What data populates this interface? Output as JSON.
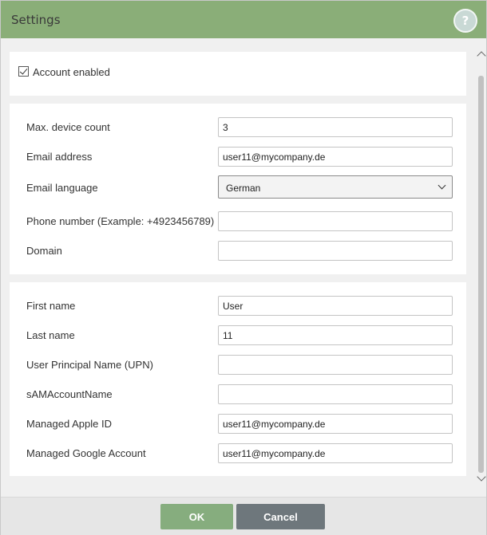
{
  "dialog": {
    "title": "Settings",
    "help_label": "?"
  },
  "account": {
    "enabled_label": "Account enabled",
    "enabled": true
  },
  "device_section": {
    "max_device_count_label": "Max. device count",
    "max_device_count_value": "3",
    "email_address_label": "Email address",
    "email_address_value": "user11@mycompany.de",
    "email_language_label": "Email language",
    "email_language_value": "German",
    "phone_label": "Phone number (Example: +4923456789)",
    "phone_value": "",
    "domain_label": "Domain",
    "domain_value": ""
  },
  "identity_section": {
    "first_name_label": "First name",
    "first_name_value": "User",
    "last_name_label": "Last name",
    "last_name_value": "11",
    "upn_label": "User Principal Name (UPN)",
    "upn_value": "",
    "sam_label": "sAMAccountName",
    "sam_value": "",
    "apple_id_label": "Managed Apple ID",
    "apple_id_value": "user11@mycompany.de",
    "google_label": "Managed Google Account",
    "google_value": "user11@mycompany.de"
  },
  "footer": {
    "ok_label": "OK",
    "cancel_label": "Cancel"
  },
  "colors": {
    "header_bg": "#8aae78",
    "ok_button": "#86ad7e",
    "cancel_button": "#6e777c",
    "content_bg": "#f0f0f0"
  },
  "icons": {
    "help": "help-icon",
    "checkbox": "checkbox-checked-icon",
    "select_chevron": "chevron-down-icon"
  }
}
